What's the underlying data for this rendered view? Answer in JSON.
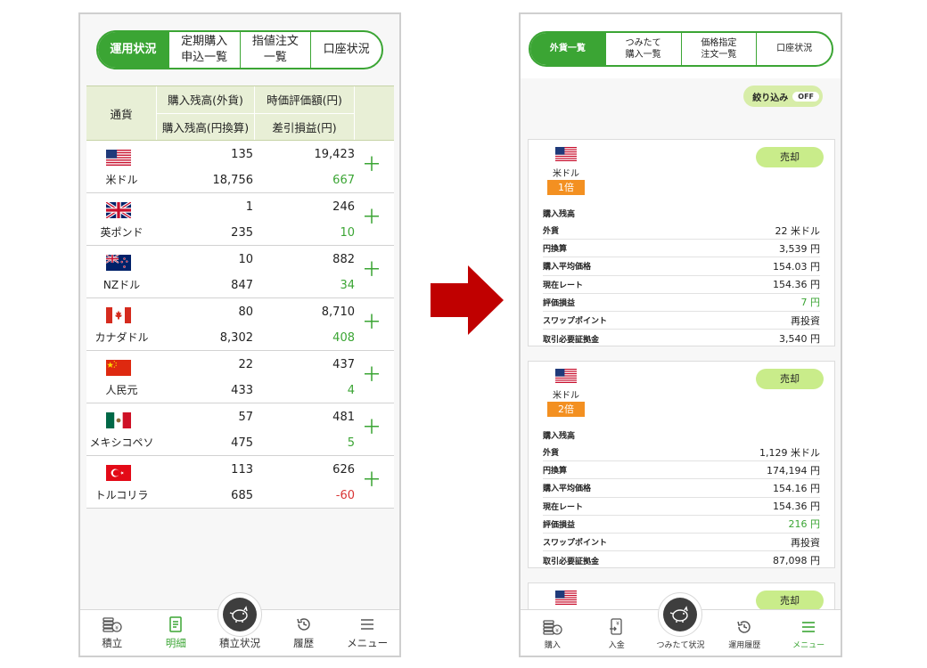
{
  "left": {
    "tabs": [
      {
        "label": "運用状況",
        "active": true
      },
      {
        "label": "定期購入\n申込一覧",
        "active": false
      },
      {
        "label": "指値注文\n一覧",
        "active": false
      },
      {
        "label": "口座状況",
        "active": false
      }
    ],
    "table": {
      "headers": {
        "currency": "通貨",
        "holding_fx": "購入残高(外貨)",
        "market_value": "時価評価額(円)",
        "holding_jpy": "購入残高(円換算)",
        "pl": "差引損益(円)"
      },
      "rows": [
        {
          "flag": "us",
          "currency": "米ドル",
          "holding_fx": "135",
          "market_value": "19,423",
          "holding_jpy": "18,756",
          "pl": "667",
          "sign": "pos"
        },
        {
          "flag": "uk",
          "currency": "英ポンド",
          "holding_fx": "1",
          "market_value": "246",
          "holding_jpy": "235",
          "pl": "10",
          "sign": "pos"
        },
        {
          "flag": "nz",
          "currency": "NZドル",
          "holding_fx": "10",
          "market_value": "882",
          "holding_jpy": "847",
          "pl": "34",
          "sign": "pos"
        },
        {
          "flag": "ca",
          "currency": "カナダドル",
          "holding_fx": "80",
          "market_value": "8,710",
          "holding_jpy": "8,302",
          "pl": "408",
          "sign": "pos"
        },
        {
          "flag": "cn",
          "currency": "人民元",
          "holding_fx": "22",
          "market_value": "437",
          "holding_jpy": "433",
          "pl": "4",
          "sign": "pos"
        },
        {
          "flag": "mx",
          "currency": "メキシコペソ",
          "holding_fx": "57",
          "market_value": "481",
          "holding_jpy": "475",
          "pl": "5",
          "sign": "pos"
        },
        {
          "flag": "tr",
          "currency": "トルコリラ",
          "holding_fx": "113",
          "market_value": "626",
          "holding_jpy": "685",
          "pl": "-60",
          "sign": "neg"
        }
      ]
    },
    "nav": [
      {
        "label": "積立",
        "icon": "coin-stack-icon",
        "active": false
      },
      {
        "label": "明細",
        "icon": "document-icon",
        "active": true
      },
      {
        "label": "積立状況",
        "icon": "piggy-bank-icon",
        "active": false
      },
      {
        "label": "履歴",
        "icon": "history-icon",
        "active": false
      },
      {
        "label": "メニュー",
        "icon": "menu-icon",
        "active": false
      }
    ]
  },
  "right": {
    "tabs": [
      {
        "label": "外貨一覧",
        "active": true
      },
      {
        "label": "つみたて\n購入一覧",
        "active": false
      },
      {
        "label": "価格指定\n注文一覧",
        "active": false
      },
      {
        "label": "口座状況",
        "active": false
      }
    ],
    "filter": {
      "label": "絞り込み",
      "state": "OFF"
    },
    "cards": [
      {
        "flag": "us",
        "currency": "米ドル",
        "multiplier": "1倍",
        "sell_label": "売却",
        "section_title": "購入残高",
        "details": [
          {
            "key": "外貨",
            "value": "22 米ドル",
            "sign": ""
          },
          {
            "key": "円換算",
            "value": "3,539 円",
            "sign": ""
          },
          {
            "key": "購入平均価格",
            "value": "154.03 円",
            "sign": ""
          },
          {
            "key": "現在レート",
            "value": "154.36 円",
            "sign": ""
          },
          {
            "key": "評価損益",
            "value": "7 円",
            "sign": "pos"
          },
          {
            "key": "スワップポイント",
            "value": "再投資",
            "sign": ""
          },
          {
            "key": "取引必要証拠金",
            "value": "3,540 円",
            "sign": ""
          }
        ]
      },
      {
        "flag": "us",
        "currency": "米ドル",
        "multiplier": "2倍",
        "sell_label": "売却",
        "section_title": "購入残高",
        "details": [
          {
            "key": "外貨",
            "value": "1,129 米ドル",
            "sign": ""
          },
          {
            "key": "円換算",
            "value": "174,194 円",
            "sign": ""
          },
          {
            "key": "購入平均価格",
            "value": "154.16 円",
            "sign": ""
          },
          {
            "key": "現在レート",
            "value": "154.36 円",
            "sign": ""
          },
          {
            "key": "評価損益",
            "value": "216 円",
            "sign": "pos"
          },
          {
            "key": "スワップポイント",
            "value": "再投資",
            "sign": ""
          },
          {
            "key": "取引必要証拠金",
            "value": "87,098 円",
            "sign": ""
          }
        ]
      },
      {
        "flag": "us",
        "sell_label": "売却"
      }
    ],
    "nav": [
      {
        "label": "購入",
        "icon": "coin-stack-icon",
        "active": false
      },
      {
        "label": "入金",
        "icon": "deposit-icon",
        "active": false
      },
      {
        "label": "つみたて状況",
        "icon": "piggy-bank-icon",
        "active": false
      },
      {
        "label": "運用履歴",
        "icon": "history-icon",
        "active": false
      },
      {
        "label": "メニュー",
        "icon": "menu-icon",
        "active": true
      }
    ]
  },
  "colors": {
    "accent": "#3ba534",
    "negative": "#d93434",
    "multiplier": "#f39021",
    "arrow": "#c00000"
  }
}
